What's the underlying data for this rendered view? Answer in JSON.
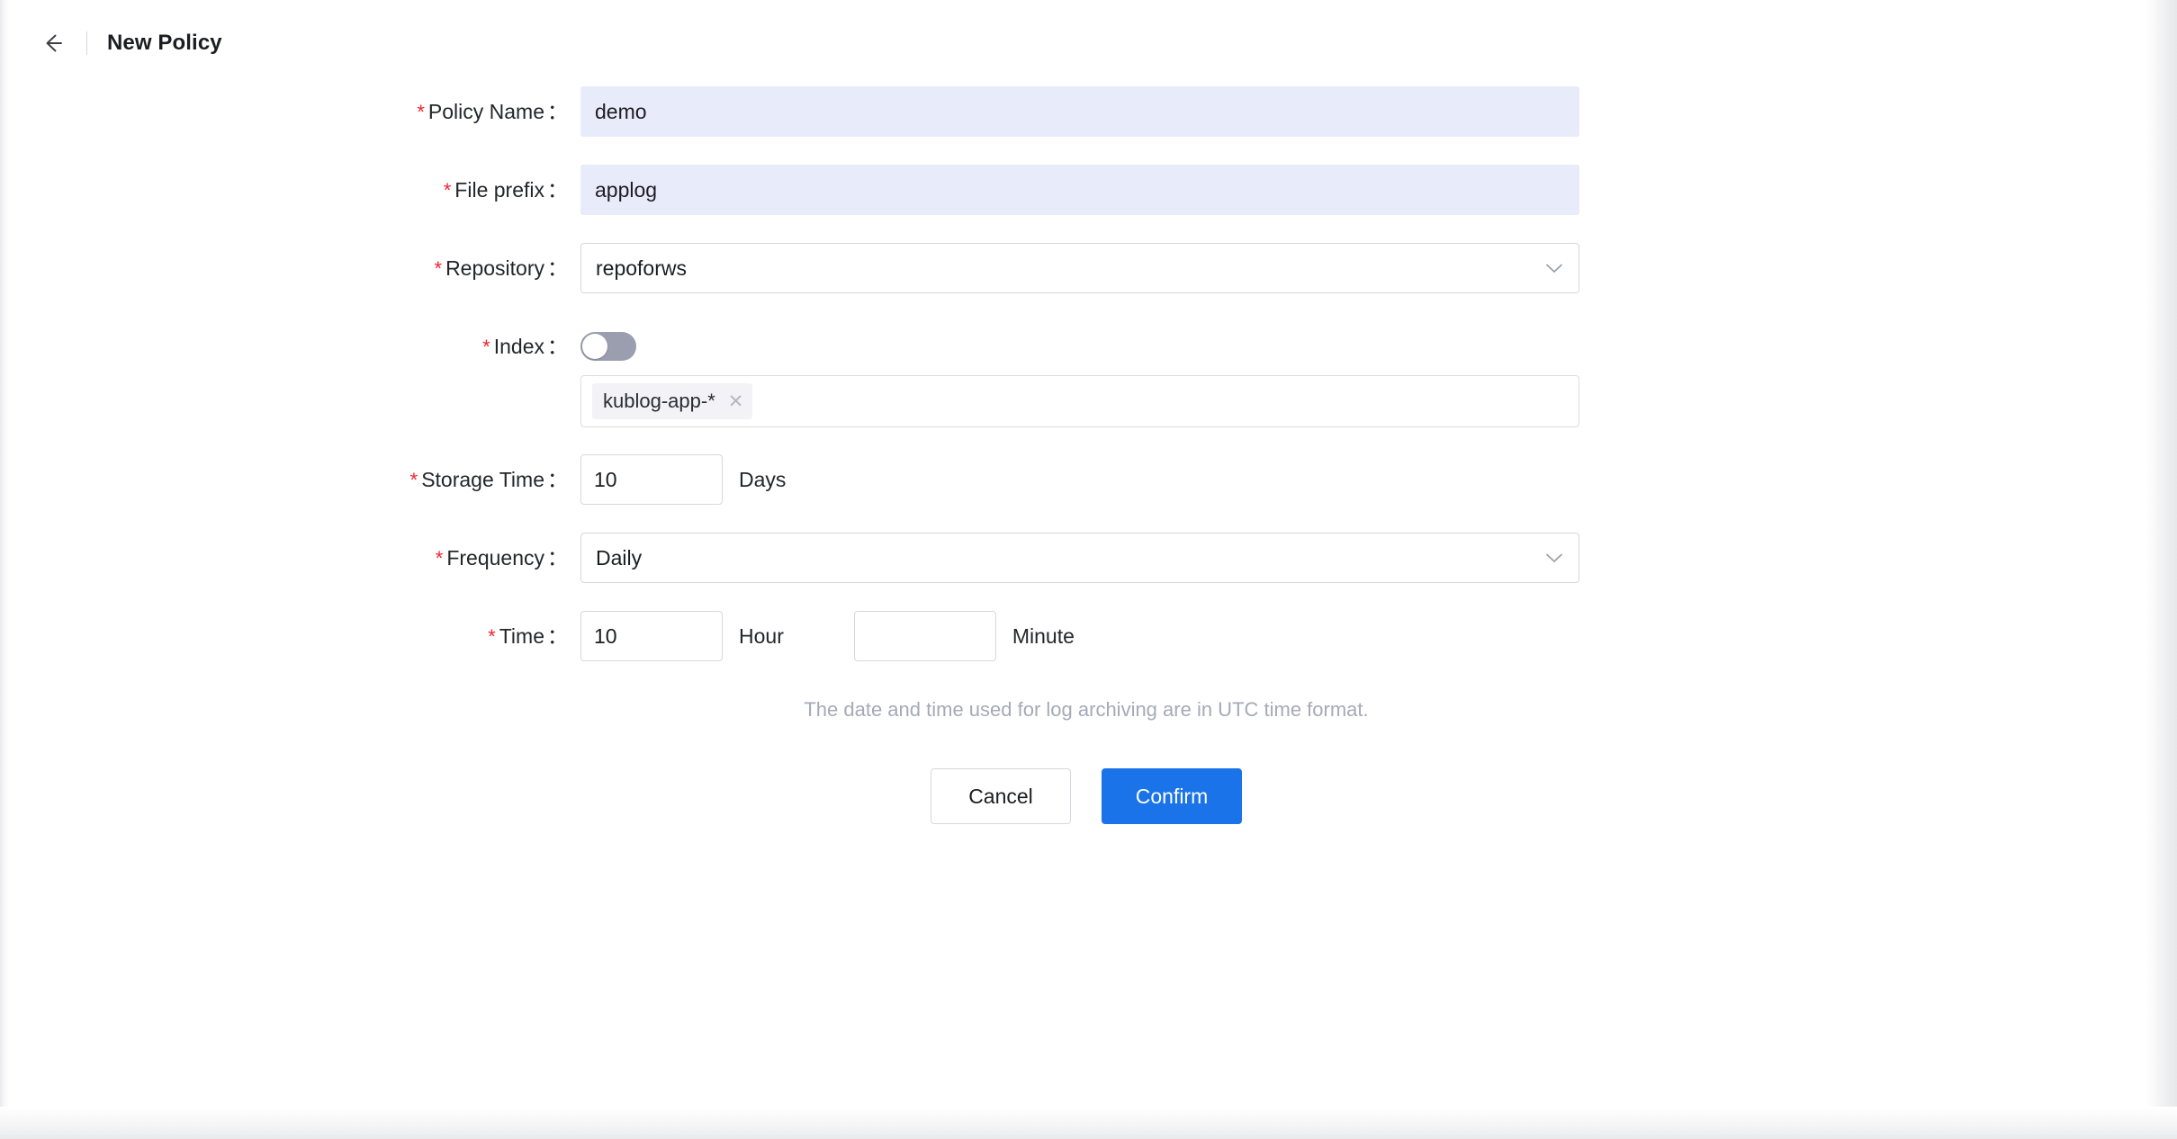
{
  "header": {
    "back_icon": "arrow-left-icon",
    "title": "New Policy"
  },
  "form": {
    "required_mark": "*",
    "colon": "：",
    "fields": {
      "policy_name": {
        "label": "Policy Name",
        "value": "demo",
        "placeholder": ""
      },
      "file_prefix": {
        "label": "File prefix",
        "value": "applog",
        "placeholder": ""
      },
      "repository": {
        "label": "Repository",
        "value": "repoforws",
        "arrow_icon": "chevron-down-icon"
      },
      "index": {
        "label": "Index",
        "toggle_state": "off",
        "tags": [
          {
            "text": "kublog-app-*",
            "remove_icon": "close-icon",
            "remove_glyph": "✕"
          }
        ]
      },
      "storage_time": {
        "label": "Storage Time",
        "value": "10",
        "unit": "Days"
      },
      "frequency": {
        "label": "Frequency",
        "value": "Daily",
        "arrow_icon": "chevron-down-icon"
      },
      "time": {
        "label": "Time",
        "hour_value": "10",
        "hour_unit": "Hour",
        "minute_value": "",
        "minute_unit": "Minute"
      }
    },
    "hint": "The date and time used for log archiving are in UTC time format."
  },
  "actions": {
    "cancel_label": "Cancel",
    "confirm_label": "Confirm"
  },
  "colors": {
    "accent_blue": "#1a73e8",
    "required_red": "#f5222d",
    "input_fill": "#e8ecfa",
    "toggle_off": "#9a9eaf",
    "hint_gray": "#a6a9b8"
  }
}
